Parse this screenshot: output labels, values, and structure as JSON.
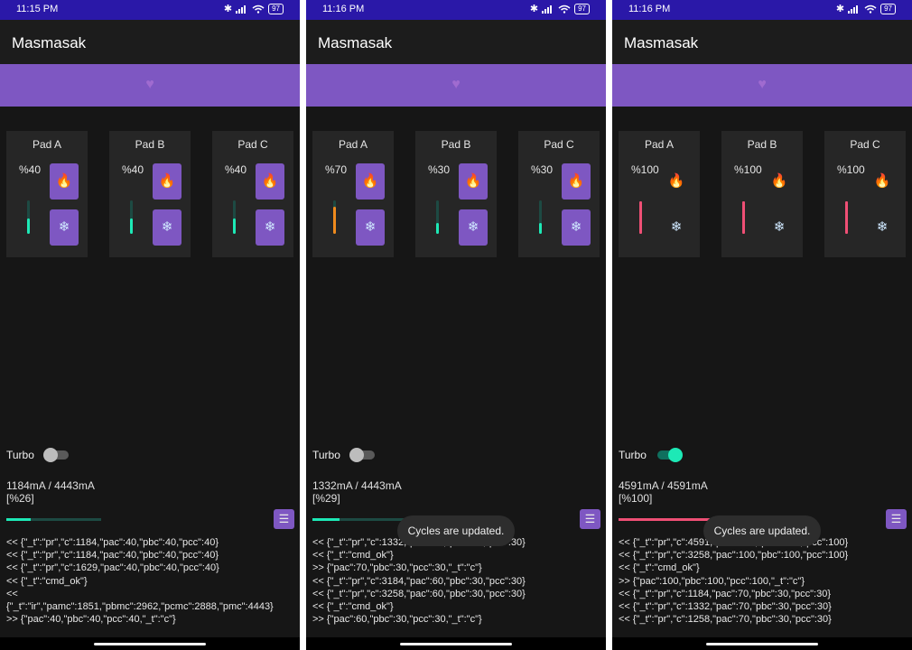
{
  "colors": {
    "status_bar": "#2a18a8",
    "accent": "#7e57c2",
    "teal": "#1de9b6",
    "orange": "#ef8a1d",
    "pink": "#ef4f75",
    "background": "#161616",
    "pad_bg": "#262626"
  },
  "phones": [
    {
      "status_time": "11:15 PM",
      "battery": "97",
      "app_title": "Masmasak",
      "pads": [
        {
          "title": "Pad A",
          "pct": "%40",
          "level": 0.45,
          "color": "#1de9b6",
          "controls_highlighted": true,
          "hot_icon": "fire-icon",
          "cold_icon": "snowflake-icon"
        },
        {
          "title": "Pad B",
          "pct": "%40",
          "level": 0.45,
          "color": "#1de9b6",
          "controls_highlighted": true,
          "hot_icon": "fire-icon",
          "cold_icon": "snowflake-icon"
        },
        {
          "title": "Pad C",
          "pct": "%40",
          "level": 0.45,
          "color": "#1de9b6",
          "controls_highlighted": true,
          "hot_icon": "fire-icon",
          "cold_icon": "snowflake-icon"
        }
      ],
      "turbo_label": "Turbo",
      "turbo_on": false,
      "current": "1184mA / 4443mA",
      "percent": "[%26]",
      "progress": 0.26,
      "progress_color": "#1de9b6",
      "log": [
        "<< {\"_t\":\"pr\",\"c\":1184,\"pac\":40,\"pbc\":40,\"pcc\":40}",
        "<< {\"_t\":\"pr\",\"c\":1184,\"pac\":40,\"pbc\":40,\"pcc\":40}",
        "<< {\"_t\":\"pr\",\"c\":1629,\"pac\":40,\"pbc\":40,\"pcc\":40}",
        "<< {\"_t\":\"cmd_ok\"}",
        "<<",
        "{\"_t\":\"ir\",\"pamc\":1851,\"pbmc\":2962,\"pcmc\":2888,\"pmc\":4443}",
        ">> {\"pac\":40,\"pbc\":40,\"pcc\":40,\"_t\":\"c\"}"
      ],
      "toast": ""
    },
    {
      "status_time": "11:16 PM",
      "battery": "97",
      "app_title": "Masmasak",
      "pads": [
        {
          "title": "Pad A",
          "pct": "%70",
          "level": 0.8,
          "color": "#ef8a1d",
          "controls_highlighted": true,
          "hot_icon": "fire-icon",
          "cold_icon": "snowflake-icon"
        },
        {
          "title": "Pad B",
          "pct": "%30",
          "level": 0.32,
          "color": "#1de9b6",
          "controls_highlighted": true,
          "hot_icon": "fire-icon",
          "cold_icon": "snowflake-icon"
        },
        {
          "title": "Pad C",
          "pct": "%30",
          "level": 0.32,
          "color": "#1de9b6",
          "controls_highlighted": true,
          "hot_icon": "fire-icon",
          "cold_icon": "snowflake-icon"
        }
      ],
      "turbo_label": "Turbo",
      "turbo_on": false,
      "current": "1332mA / 4443mA",
      "percent": "[%29]",
      "progress": 0.29,
      "progress_color": "#1de9b6",
      "log": [
        "<< {\"_t\":\"pr\",\"c\":1332,\"pac\":60,\"pbc\":30,\"pcc\":30}",
        "<< {\"_t\":\"cmd_ok\"}",
        ">> {\"pac\":70,\"pbc\":30,\"pcc\":30,\"_t\":\"c\"}",
        "<< {\"_t\":\"pr\",\"c\":3184,\"pac\":60,\"pbc\":30,\"pcc\":30}",
        "<< {\"_t\":\"pr\",\"c\":3258,\"pac\":60,\"pbc\":30,\"pcc\":30}",
        "<< {\"_t\":\"cmd_ok\"}",
        ">> {\"pac\":60,\"pbc\":30,\"pcc\":30,\"_t\":\"c\"}"
      ],
      "toast": "Cycles are updated."
    },
    {
      "status_time": "11:16 PM",
      "battery": "97",
      "app_title": "Masmasak",
      "pads": [
        {
          "title": "Pad A",
          "pct": "%100",
          "level": 1.0,
          "color": "#ef4f75",
          "controls_highlighted": false,
          "hot_icon": "fire-icon",
          "cold_icon": "snowflake-icon"
        },
        {
          "title": "Pad B",
          "pct": "%100",
          "level": 1.0,
          "color": "#ef4f75",
          "controls_highlighted": false,
          "hot_icon": "fire-icon",
          "cold_icon": "snowflake-icon"
        },
        {
          "title": "Pad C",
          "pct": "%100",
          "level": 1.0,
          "color": "#ef4f75",
          "controls_highlighted": false,
          "hot_icon": "fire-icon",
          "cold_icon": "snowflake-icon"
        }
      ],
      "turbo_label": "Turbo",
      "turbo_on": true,
      "current": "4591mA / 4591mA",
      "percent": "[%100]",
      "progress": 1.0,
      "progress_color": "#ef4f75",
      "log": [
        "<< {\"_t\":\"pr\",\"c\":4591,\"pac\":100,\"pbc\":100,\"pcc\":100}",
        "<< {\"_t\":\"pr\",\"c\":3258,\"pac\":100,\"pbc\":100,\"pcc\":100}",
        "<< {\"_t\":\"cmd_ok\"}",
        ">> {\"pac\":100,\"pbc\":100,\"pcc\":100,\"_t\":\"c\"}",
        "<< {\"_t\":\"pr\",\"c\":1184,\"pac\":70,\"pbc\":30,\"pcc\":30}",
        "<< {\"_t\":\"pr\",\"c\":1332,\"pac\":70,\"pbc\":30,\"pcc\":30}",
        "<< {\"_t\":\"pr\",\"c\":1258,\"pac\":70,\"pbc\":30,\"pcc\":30}"
      ],
      "toast": "Cycles are updated."
    }
  ]
}
